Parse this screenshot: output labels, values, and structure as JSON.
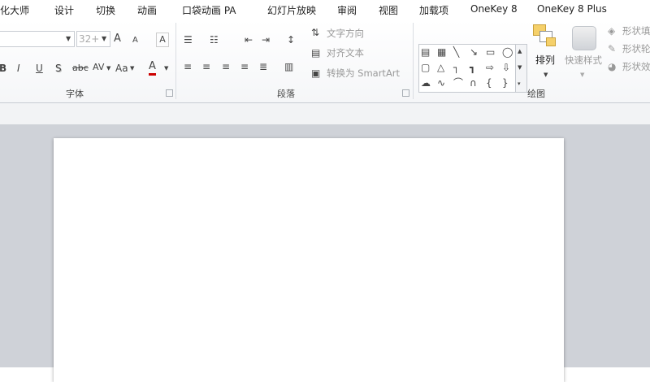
{
  "tabs": [
    "美化大师",
    "设计",
    "切换",
    "动画",
    "口袋动画 PA",
    "幻灯片放映",
    "审阅",
    "视图",
    "加载项",
    "OneKey 8",
    "OneKey 8 Plus"
  ],
  "font_group": {
    "label": "字体",
    "font_size": "32+",
    "grow_font": "A",
    "shrink_font": "A",
    "clear_format": "A",
    "bold": "B",
    "italic": "I",
    "underline": "U",
    "shadow": "S",
    "strikethrough": "abc",
    "char_spacing": "AV",
    "change_case": "Aa",
    "font_color": "A"
  },
  "paragraph_group": {
    "label": "段落",
    "text_direction": "文字方向",
    "align_text": "对齐文本",
    "convert_smartart": "转换为 SmartArt"
  },
  "drawing_group": {
    "label": "绘图",
    "arrange": "排列",
    "quick_styles": "快速样式",
    "shape_fill": "形状填",
    "shape_outline": "形状轮",
    "shape_effects": "形状效"
  },
  "icons": [
    "dropdown-arrow",
    "grow-font-icon",
    "shrink-font-icon",
    "clear-format-icon",
    "bullets-icon",
    "numbering-icon",
    "decrease-indent-icon",
    "increase-indent-icon",
    "line-spacing-icon",
    "align-left-icon",
    "center-icon",
    "align-right-icon",
    "justify-icon",
    "distributed-icon",
    "columns-icon",
    "text-direction-icon",
    "align-text-icon",
    "smartart-icon",
    "shape-gallery",
    "arrange-icon",
    "quick-styles-icon",
    "fill-icon",
    "outline-icon",
    "effects-icon",
    "dialog-launcher-icon"
  ]
}
